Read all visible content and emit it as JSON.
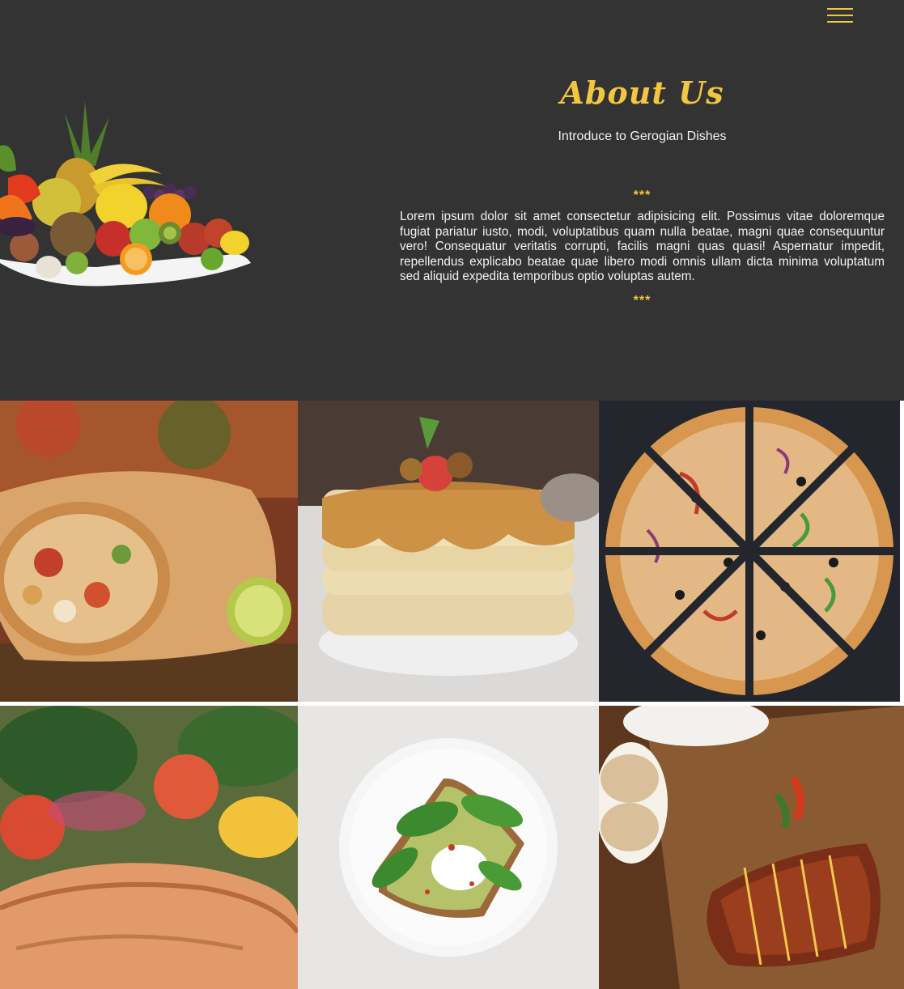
{
  "header": {
    "menu_icon": "hamburger-menu-icon",
    "accent_color": "#f3c63f",
    "background_color": "#333333"
  },
  "about": {
    "title": "About Us",
    "subtitle": "Introduce to Gerogian Dishes",
    "divider_top": "***",
    "body": "Lorem ipsum dolor sit amet consectetur adipisicing elit. Possimus vitae doloremque fugiat pariatur iusto, modi, voluptatibus quam nulla beatae, magni quae consequuntur vero! Consequatur veritatis corrupti, facilis magni quas quasi! Aspernatur impedit, repellendus explicabo beatae quae libero modi omnis ullam dicta minima voluptatum sed aliquid expedita temporibus optio voluptas autem.",
    "divider_bottom": "***"
  },
  "gallery": {
    "tiles": [
      {
        "icon": "burrito-photo"
      },
      {
        "icon": "pancakes-photo"
      },
      {
        "icon": "pizza-photo"
      },
      {
        "icon": "salmon-salad-photo"
      },
      {
        "icon": "avocado-toast-photo"
      },
      {
        "icon": "grilled-steak-photo"
      }
    ]
  }
}
